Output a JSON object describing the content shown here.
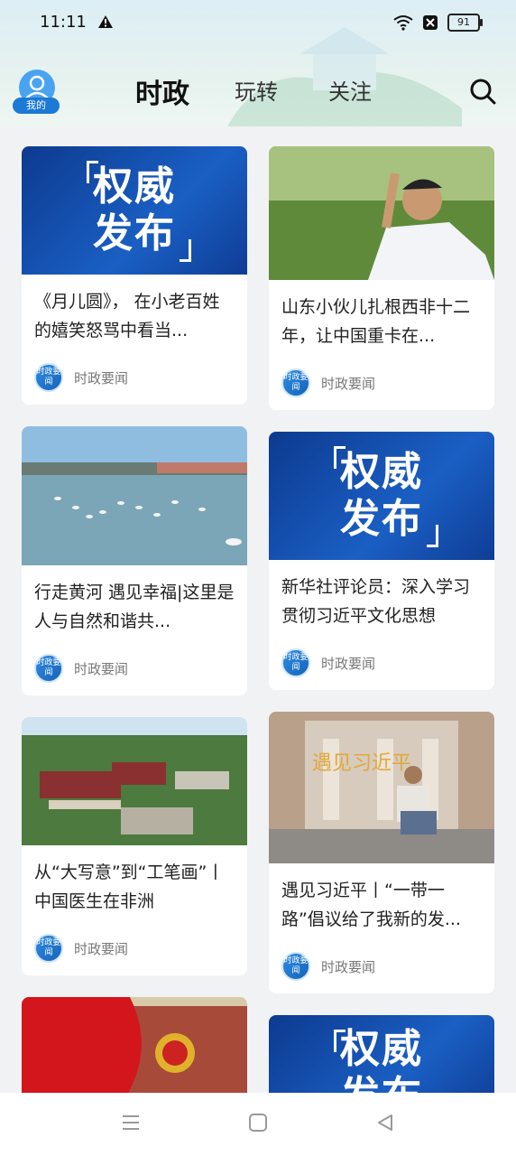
{
  "status": {
    "time": "11:11",
    "battery": "91"
  },
  "header": {
    "avatar_label": "我的",
    "tabs": [
      {
        "label": "时政"
      },
      {
        "label": "玩转"
      },
      {
        "label": "关注"
      }
    ]
  },
  "left_column": [
    {
      "title": "《月儿圆》， 在小老百姓的嬉笑怒骂中看当...",
      "source": "时政要闻",
      "logo_text": "时政要闻",
      "image_text": [
        "权威",
        "发布"
      ]
    },
    {
      "title": "行走黄河 遇见幸福|这里是人与自然和谐共...",
      "source": "时政要闻",
      "logo_text": "时政要闻"
    },
    {
      "title": "从“大写意”到“工笔画”丨中国医生在非洲",
      "source": "时政要闻",
      "logo_text": "时政要闻"
    }
  ],
  "right_column": [
    {
      "title": "山东小伙儿扎根西非十二年，让中国重卡在...",
      "source": "时政要闻",
      "logo_text": "时政要闻"
    },
    {
      "title": "新华社评论员：深入学习贯彻习近平文化思想",
      "source": "时政要闻",
      "logo_text": "时政要闻",
      "image_text": [
        "权威",
        "发布"
      ]
    },
    {
      "title": "遇见习近平丨“一带一路”倡议给了我新的发...",
      "source": "时政要闻",
      "logo_text": "时政要闻",
      "image_text": "遇见习近平"
    }
  ],
  "partial": {
    "right_image_text": [
      "权威",
      "发布"
    ]
  }
}
